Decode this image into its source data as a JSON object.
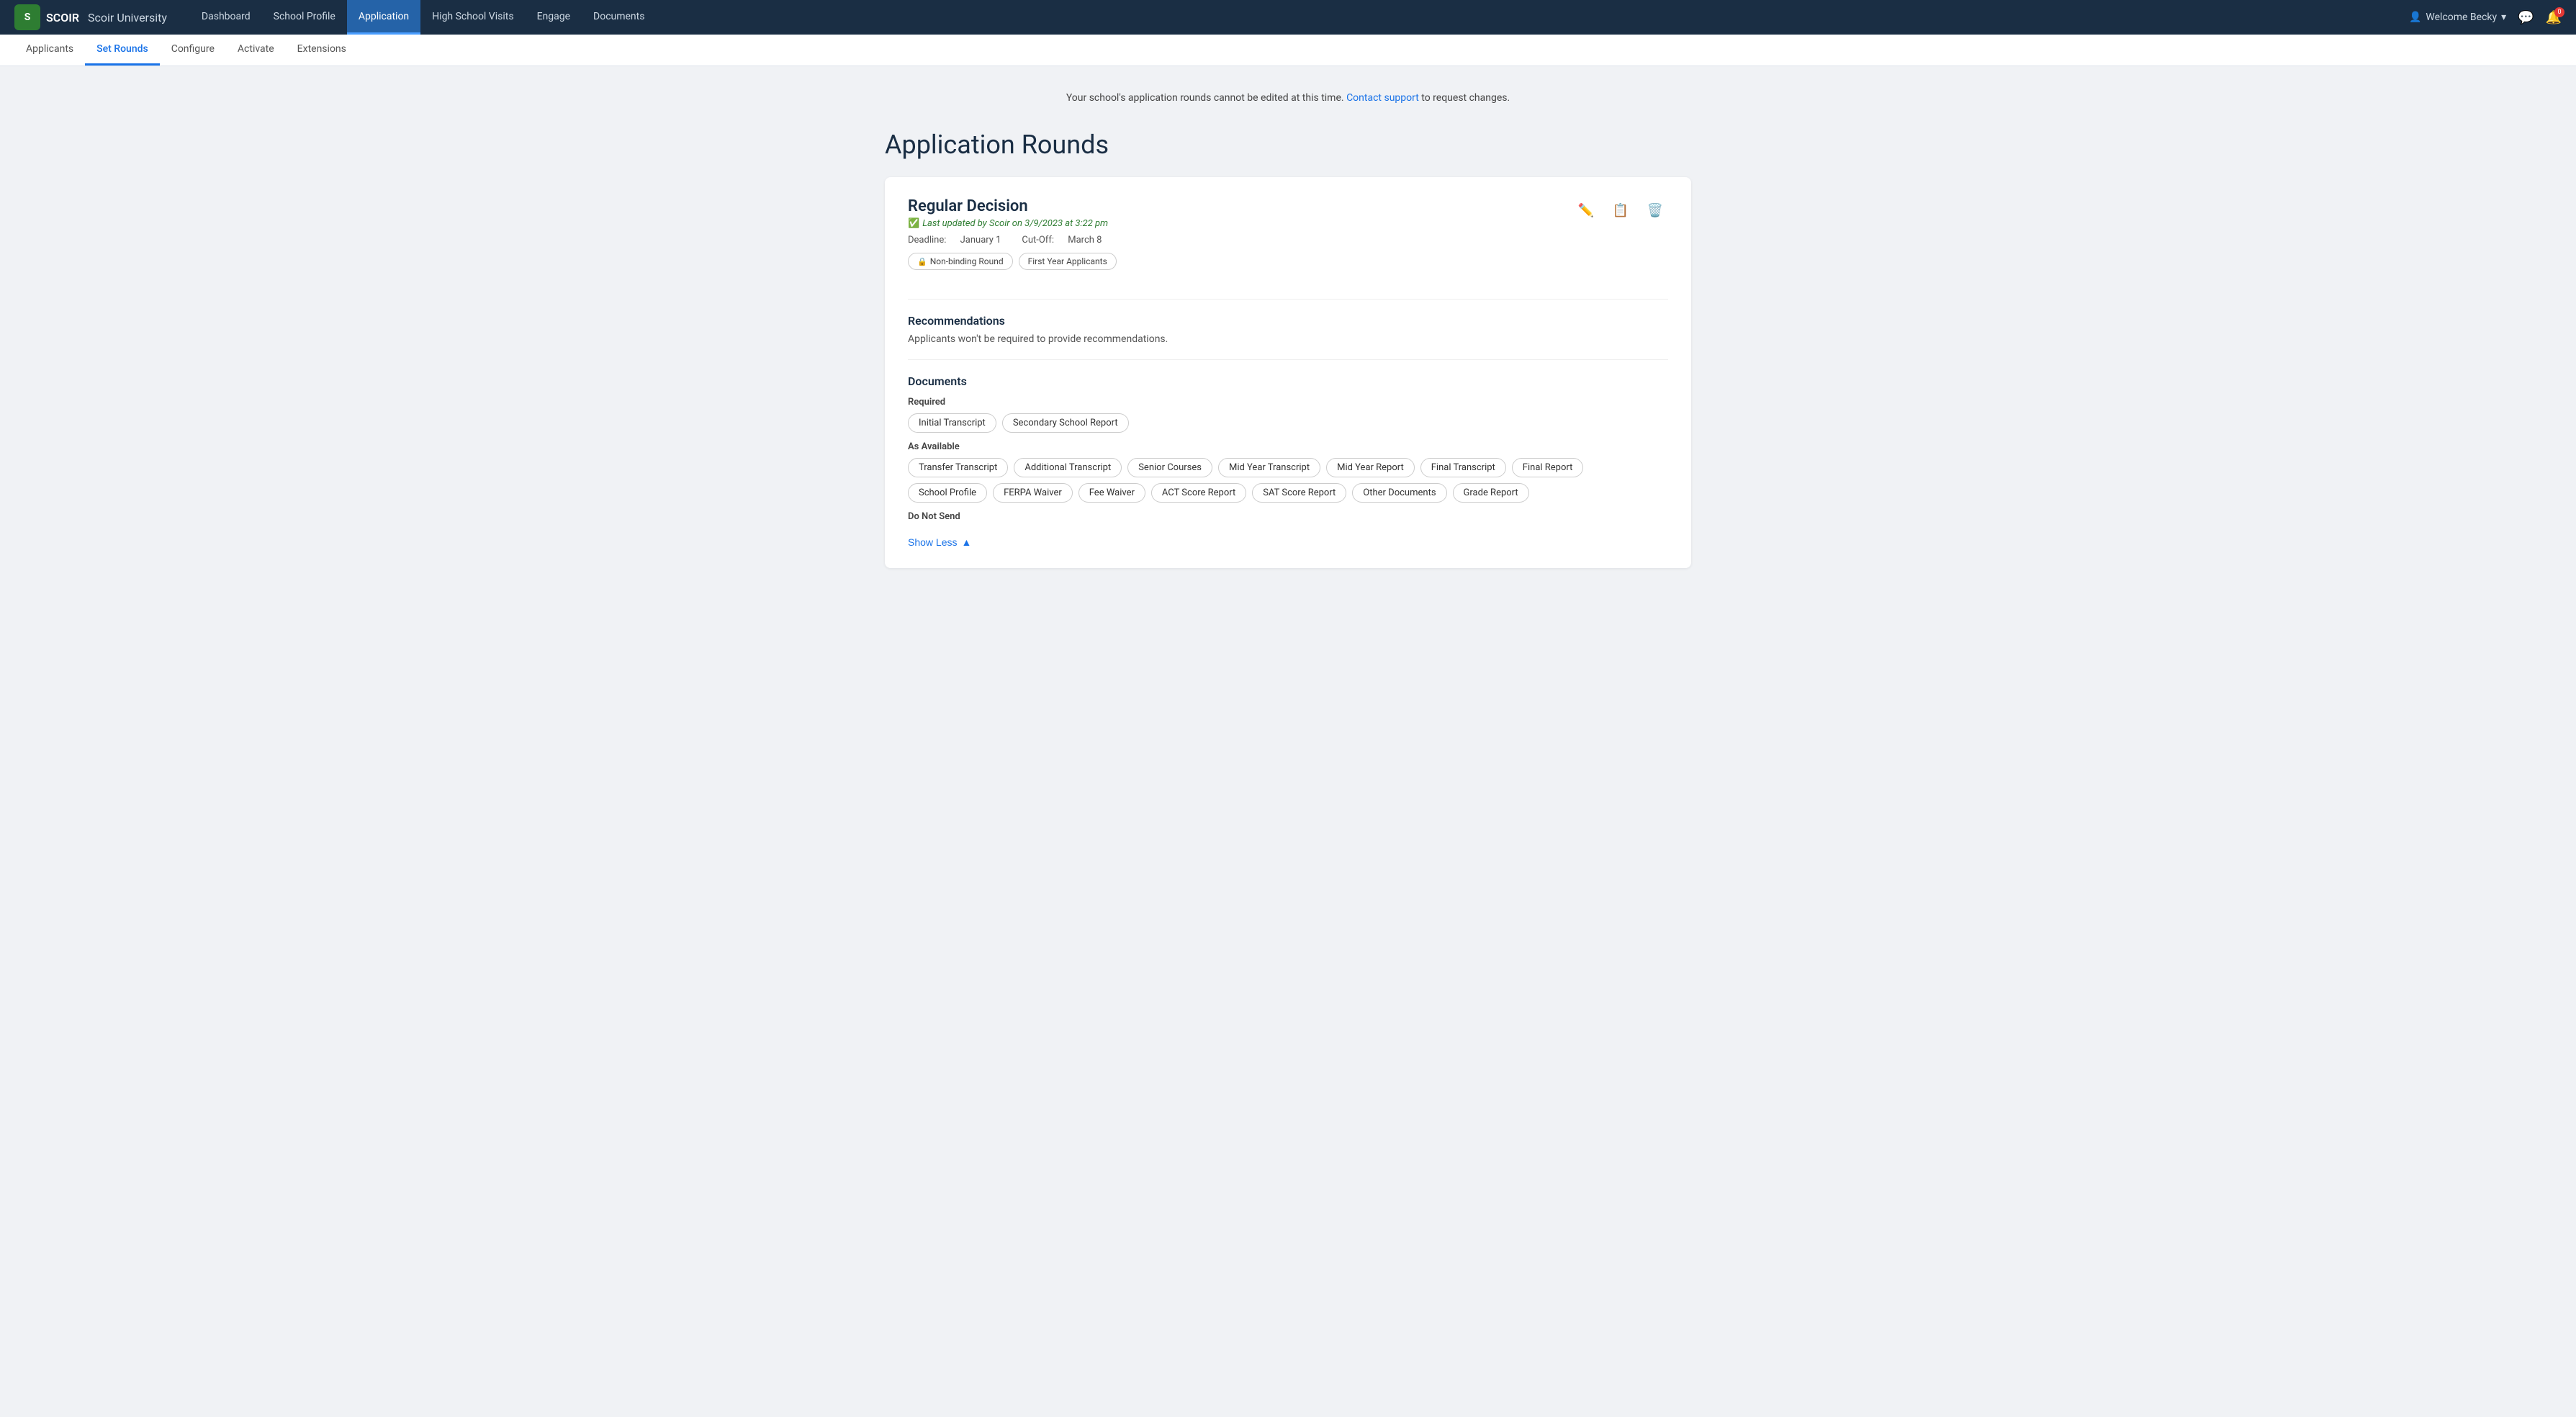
{
  "app": {
    "logo_text": "SCOIR",
    "university_name": "Scoir University"
  },
  "top_nav": {
    "items": [
      {
        "id": "dashboard",
        "label": "Dashboard",
        "active": false
      },
      {
        "id": "school-profile",
        "label": "School Profile",
        "active": false
      },
      {
        "id": "application",
        "label": "Application",
        "active": true
      },
      {
        "id": "high-school-visits",
        "label": "High School Visits",
        "active": false
      },
      {
        "id": "engage",
        "label": "Engage",
        "active": false
      },
      {
        "id": "documents",
        "label": "Documents",
        "active": false
      }
    ]
  },
  "top_bar_right": {
    "welcome_text": "Welcome Becky",
    "notification_count": "0"
  },
  "sub_nav": {
    "items": [
      {
        "id": "applicants",
        "label": "Applicants",
        "active": false
      },
      {
        "id": "set-rounds",
        "label": "Set Rounds",
        "active": true
      },
      {
        "id": "configure",
        "label": "Configure",
        "active": false
      },
      {
        "id": "activate",
        "label": "Activate",
        "active": false
      },
      {
        "id": "extensions",
        "label": "Extensions",
        "active": false
      }
    ]
  },
  "banner": {
    "text_before": "Your school's application rounds cannot be edited at this time.",
    "link_text": "Contact support",
    "text_after": "to request changes."
  },
  "page": {
    "title": "Application Rounds"
  },
  "round": {
    "title": "Regular Decision",
    "last_updated": "Last updated by Scoir on 3/9/2023 at 3:22 pm",
    "deadline_label": "Deadline:",
    "deadline_value": "January 1",
    "cutoff_label": "Cut-Off:",
    "cutoff_value": "March 8",
    "tags": [
      {
        "label": "Non-binding Round",
        "has_lock": true
      },
      {
        "label": "First Year Applicants",
        "has_lock": false
      }
    ],
    "recommendations_title": "Recommendations",
    "recommendations_text": "Applicants won't be required to provide recommendations.",
    "documents_title": "Documents",
    "required_label": "Required",
    "required_docs": [
      {
        "label": "Initial Transcript"
      },
      {
        "label": "Secondary School Report"
      }
    ],
    "as_available_label": "As Available",
    "as_available_docs": [
      {
        "label": "Transfer Transcript"
      },
      {
        "label": "Additional Transcript"
      },
      {
        "label": "Senior Courses"
      },
      {
        "label": "Mid Year Transcript"
      },
      {
        "label": "Mid Year Report"
      },
      {
        "label": "Final Transcript"
      },
      {
        "label": "Final Report"
      },
      {
        "label": "School Profile"
      },
      {
        "label": "FERPA Waiver"
      },
      {
        "label": "Fee Waiver"
      },
      {
        "label": "ACT Score Report"
      },
      {
        "label": "SAT Score Report"
      },
      {
        "label": "Other Documents"
      },
      {
        "label": "Grade Report"
      }
    ],
    "do_not_send_label": "Do Not Send",
    "show_less_label": "Show Less"
  }
}
